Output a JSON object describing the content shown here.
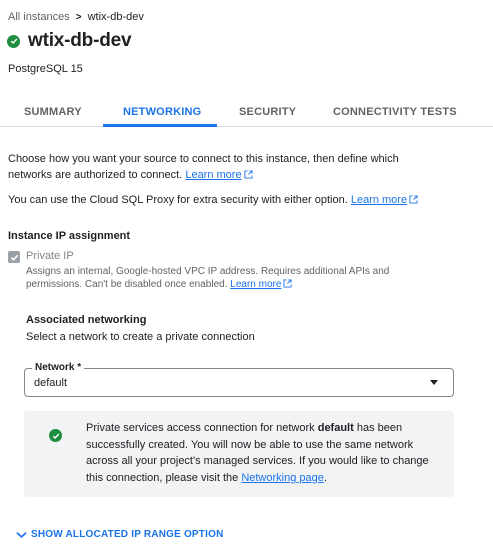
{
  "breadcrumb": {
    "parent": "All instances",
    "separator": ">",
    "current": "wtix-db-dev"
  },
  "instance": {
    "name": "wtix-db-dev",
    "status_icon": "check-circle-icon",
    "database_version": "PostgreSQL 15"
  },
  "tabs": [
    {
      "label": "SUMMARY",
      "active": false
    },
    {
      "label": "NETWORKING",
      "active": true
    },
    {
      "label": "SECURITY",
      "active": false
    },
    {
      "label": "CONNECTIVITY TESTS",
      "active": false
    }
  ],
  "intro": {
    "text": "Choose how you want your source to connect to this instance, then define which networks are authorized to connect.",
    "learn_more": "Learn more"
  },
  "proxy": {
    "text": "You can use the Cloud SQL Proxy for extra security with either option.",
    "learn_more": "Learn more"
  },
  "ip_assignment": {
    "title": "Instance IP assignment",
    "private_ip_label": "Private IP",
    "private_ip_checked": true,
    "private_ip_help": "Assigns an internal, Google-hosted VPC IP address. Requires additional APIs and permissions. Can't be disabled once enabled.",
    "learn_more": "Learn more"
  },
  "associated_networking": {
    "title": "Associated networking",
    "subtitle": "Select a network to create a private connection",
    "network_label": "Network *",
    "network_value": "default"
  },
  "info_box": {
    "text_before": "Private services access connection for network ",
    "network_name": "default",
    "text_after": " has been successfully created. You will now be able to use the same network across all your project's managed services. If you would like to change this connection, please visit the ",
    "link": "Networking page",
    "text_end": "."
  },
  "expander": {
    "label": "SHOW ALLOCATED IP RANGE OPTION"
  },
  "colors": {
    "accent": "#1a73e8",
    "success": "#1e8e3e",
    "muted": "#5f6368",
    "info_bg": "#f1f3f4"
  }
}
